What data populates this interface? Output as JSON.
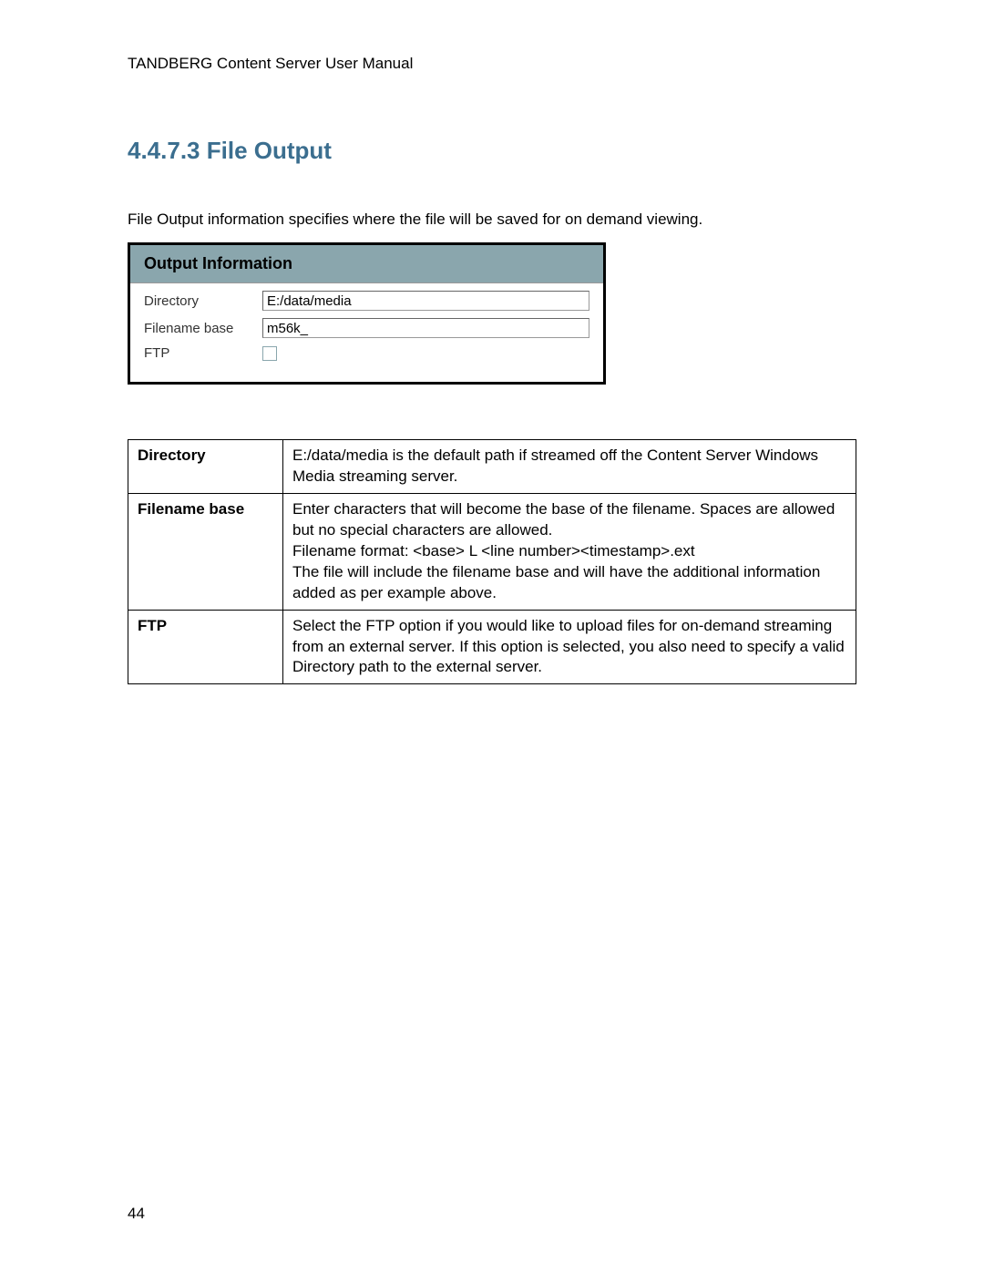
{
  "header": "TANDBERG Content Server User Manual",
  "section": {
    "number": "4.4.7.3",
    "title": "File Output"
  },
  "intro": "File Output information specifies where the file will be saved for on demand viewing.",
  "form": {
    "title": "Output Information",
    "directory_label": "Directory",
    "directory_value": "E:/data/media",
    "filename_label": "Filename base",
    "filename_value": "m56k_",
    "ftp_label": "FTP"
  },
  "descriptions": {
    "rows": [
      {
        "label": "Directory",
        "text": "E:/data/media is the default path if streamed off the Content Server Windows Media streaming server."
      },
      {
        "label": "Filename base",
        "text": "Enter characters that will become the base of the filename. Spaces are allowed but no special characters are allowed.\nFilename format: <base> L <line number><timestamp>.ext\nThe file will include the filename base and will have the additional information added as per example above."
      },
      {
        "label": "FTP",
        "text": "Select the FTP option if you would like to upload files for on-demand streaming from an external server. If this option is selected, you also need to specify a valid Directory path to the external server."
      }
    ]
  },
  "page_number": "44"
}
